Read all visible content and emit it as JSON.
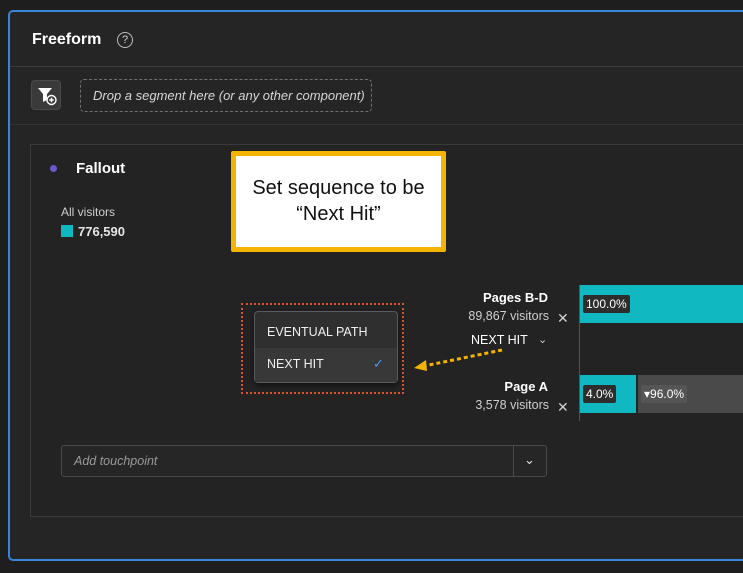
{
  "header": {
    "title": "Freeform",
    "help_glyph": "?"
  },
  "segment_bar": {
    "drop_placeholder": "Drop a segment here (or any other component)"
  },
  "fallout": {
    "title": "Fallout",
    "segment": {
      "label": "All visitors",
      "value": "776,590",
      "color": "#10b8c2"
    },
    "touchpoints": [
      {
        "label": "Pages B-D",
        "visitors": "89,867 visitors",
        "pct": "100.0%",
        "fill_fraction": 1.0
      },
      {
        "label": "Page A",
        "visitors": "3,578 visitors",
        "pct": "4.0%",
        "fallout_pct": "▾96.0%",
        "fill_fraction": 0.04
      }
    ],
    "sequence": {
      "selected_label": "NEXT HIT"
    },
    "menu": {
      "items": [
        {
          "label": "EVENTUAL PATH",
          "selected": false
        },
        {
          "label": "NEXT HIT",
          "selected": true
        }
      ]
    },
    "add_touchpoint_placeholder": "Add touchpoint"
  },
  "callout": {
    "line1": "Set sequence to be",
    "line2": "“Next Hit”"
  },
  "colors": {
    "accent": "#10b8c2",
    "border": "#3a86d6",
    "callout_border": "#f5b400",
    "highlight": "#d9542f"
  }
}
